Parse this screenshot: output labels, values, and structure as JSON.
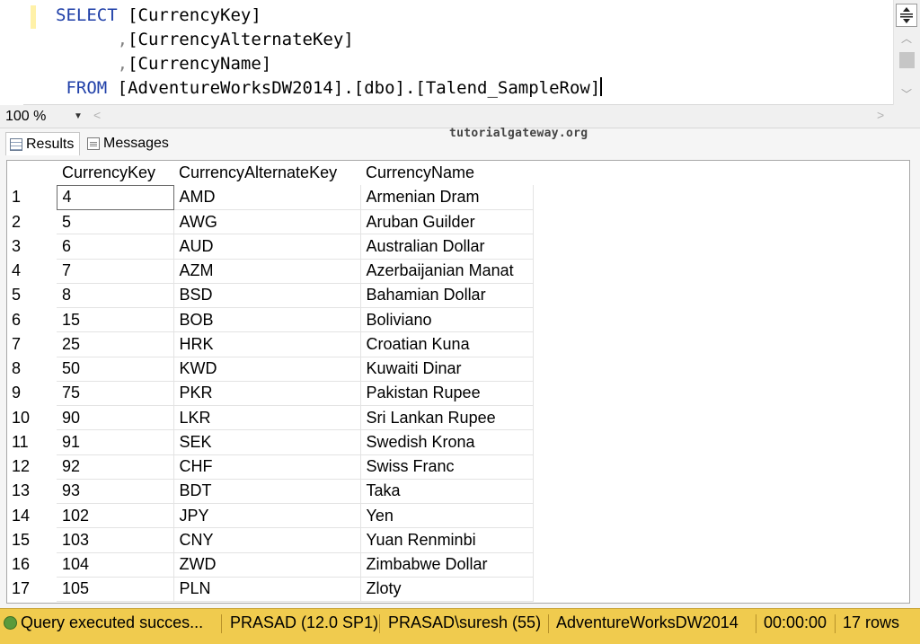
{
  "editor": {
    "lines": [
      {
        "indent": "",
        "keyword": "SELECT",
        "sep": "",
        "text": " [CurrencyKey]"
      },
      {
        "indent": "      ",
        "keyword": "",
        "sep": ",",
        "text": "[CurrencyAlternateKey]"
      },
      {
        "indent": "      ",
        "keyword": "",
        "sep": ",",
        "text": "[CurrencyName]"
      },
      {
        "indent": " ",
        "keyword": "FROM",
        "sep": "",
        "text": " [AdventureWorksDW2014].[dbo].[Talend_SampleRow]"
      }
    ]
  },
  "zoom": {
    "value": "100 %"
  },
  "tabs": {
    "results": "Results",
    "messages": "Messages"
  },
  "watermark": "tutorialgateway.org",
  "grid": {
    "columns": [
      "",
      "CurrencyKey",
      "CurrencyAlternateKey",
      "CurrencyName"
    ],
    "rows": [
      [
        "1",
        "4",
        "AMD",
        "Armenian Dram"
      ],
      [
        "2",
        "5",
        "AWG",
        "Aruban Guilder"
      ],
      [
        "3",
        "6",
        "AUD",
        "Australian Dollar"
      ],
      [
        "4",
        "7",
        "AZM",
        "Azerbaijanian Manat"
      ],
      [
        "5",
        "8",
        "BSD",
        "Bahamian Dollar"
      ],
      [
        "6",
        "15",
        "BOB",
        "Boliviano"
      ],
      [
        "7",
        "25",
        "HRK",
        "Croatian Kuna"
      ],
      [
        "8",
        "50",
        "KWD",
        "Kuwaiti Dinar"
      ],
      [
        "9",
        "75",
        "PKR",
        "Pakistan Rupee"
      ],
      [
        "10",
        "90",
        "LKR",
        "Sri Lankan Rupee"
      ],
      [
        "11",
        "91",
        "SEK",
        "Swedish Krona"
      ],
      [
        "12",
        "92",
        "CHF",
        "Swiss Franc"
      ],
      [
        "13",
        "93",
        "BDT",
        "Taka"
      ],
      [
        "14",
        "102",
        "JPY",
        "Yen"
      ],
      [
        "15",
        "103",
        "CNY",
        "Yuan Renminbi"
      ],
      [
        "16",
        "104",
        "ZWD",
        "Zimbabwe Dollar"
      ],
      [
        "17",
        "105",
        "PLN",
        "Zloty"
      ]
    ]
  },
  "status": {
    "message": "Query executed succes...",
    "server": "PRASAD (12.0 SP1)",
    "user": "PRASAD\\suresh (55)",
    "database": "AdventureWorksDW2014",
    "elapsed": "00:00:00",
    "rows": "17 rows"
  },
  "colors": {
    "status_bar": "#f0cb4e",
    "keyword": "#1f3fa8",
    "operator": "#808080"
  }
}
